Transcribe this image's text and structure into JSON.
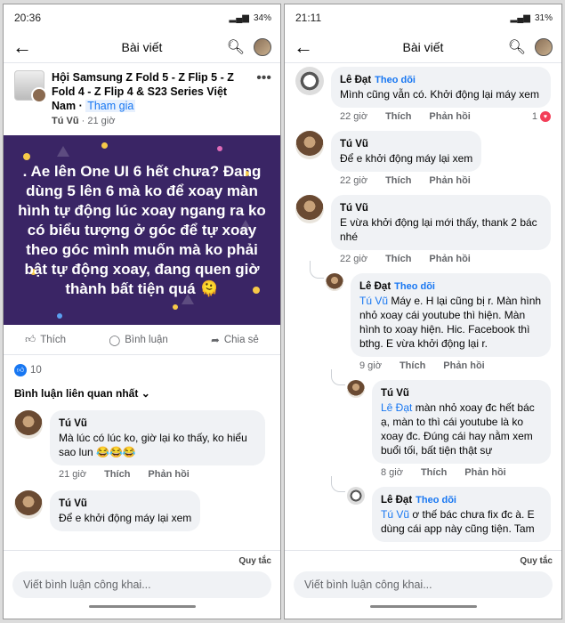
{
  "left": {
    "status": {
      "time": "20:36",
      "battery": "34%"
    },
    "header": {
      "title": "Bài viết"
    },
    "group": {
      "name": "Hội Samsung Z Fold 5 - Z Flip 5 - Z Fold 4 - Z Flip 4 & S23 Series Việt Nam · ",
      "join": "Tham gia",
      "author": "Tú Vũ",
      "time": "21 giờ"
    },
    "post_text": ". Ae lên One UI 6 hết chưa? Đang dùng 5 lên 6 mà ko để xoay màn hình tự động lúc xoay ngang ra ko có biểu tượng ở góc để tự xoay theo góc mình muốn mà ko phải bật tự động xoay, đang quen giờ thành bất tiện quá 🫠",
    "actions": {
      "like": "Thích",
      "comment": "Bình luận",
      "share": "Chia sẻ"
    },
    "reactions": "10",
    "sort": "Bình luận liên quan nhất",
    "comments": [
      {
        "name": "Tú Vũ",
        "text": "Mà lúc có lúc ko, giờ lại ko thấy, ko hiểu sao lun 😂😂😂",
        "time": "21 giờ",
        "like": "Thích",
        "reply": "Phản hồi"
      },
      {
        "name": "Tú Vũ",
        "text": "Để e khởi động máy lại xem"
      }
    ],
    "rules": "Quy tắc",
    "input_placeholder": "Viết bình luận công khai..."
  },
  "right": {
    "status": {
      "time": "21:11",
      "battery": "31%"
    },
    "header": {
      "title": "Bài viết"
    },
    "comments": [
      {
        "name": "Lê Đạt",
        "follow": "Theo dõi",
        "text": "Mình cũng vẫn có. Khởi động lại máy xem",
        "time": "22 giờ",
        "like": "Thích",
        "reply": "Phản hồi",
        "count": "1"
      },
      {
        "name": "Tú Vũ",
        "text": "Để e khởi động máy lại xem",
        "time": "22 giờ",
        "like": "Thích",
        "reply": "Phản hồi"
      },
      {
        "name": "Tú Vũ",
        "text": "E vừa khởi động lại mới thấy, thank 2 bác nhé",
        "time": "22 giờ",
        "like": "Thích",
        "reply": "Phản hồi"
      }
    ],
    "replies": [
      {
        "name": "Lê Đạt",
        "follow": "Theo dõi",
        "tag": "Tú Vũ",
        "text": " Máy e. H lại cũng bị r. Màn hình nhỏ xoay cái youtube thì hiện. Màn hình to xoay hiện. Hic. Facebook thì bthg. E vừa khởi động lại r.",
        "time": "9 giờ",
        "like": "Thích",
        "reply": "Phản hồi"
      },
      {
        "name": "Tú Vũ",
        "tag": "Lê Đạt",
        "text": " màn nhỏ xoay đc hết bác ạ, màn to thì cái youtube là ko xoay đc. Đúng cái hay nằm xem buổi tối, bất tiện thật sự",
        "time": "8 giờ",
        "like": "Thích",
        "reply": "Phản hồi"
      },
      {
        "name": "Lê Đạt",
        "follow": "Theo dõi",
        "tag": "Tú Vũ",
        "text": " ơ thế bác chưa fix đc à. E dùng cái app này cũng tiện. Tam"
      }
    ],
    "rules": "Quy tắc",
    "input_placeholder": "Viết bình luận công khai..."
  }
}
